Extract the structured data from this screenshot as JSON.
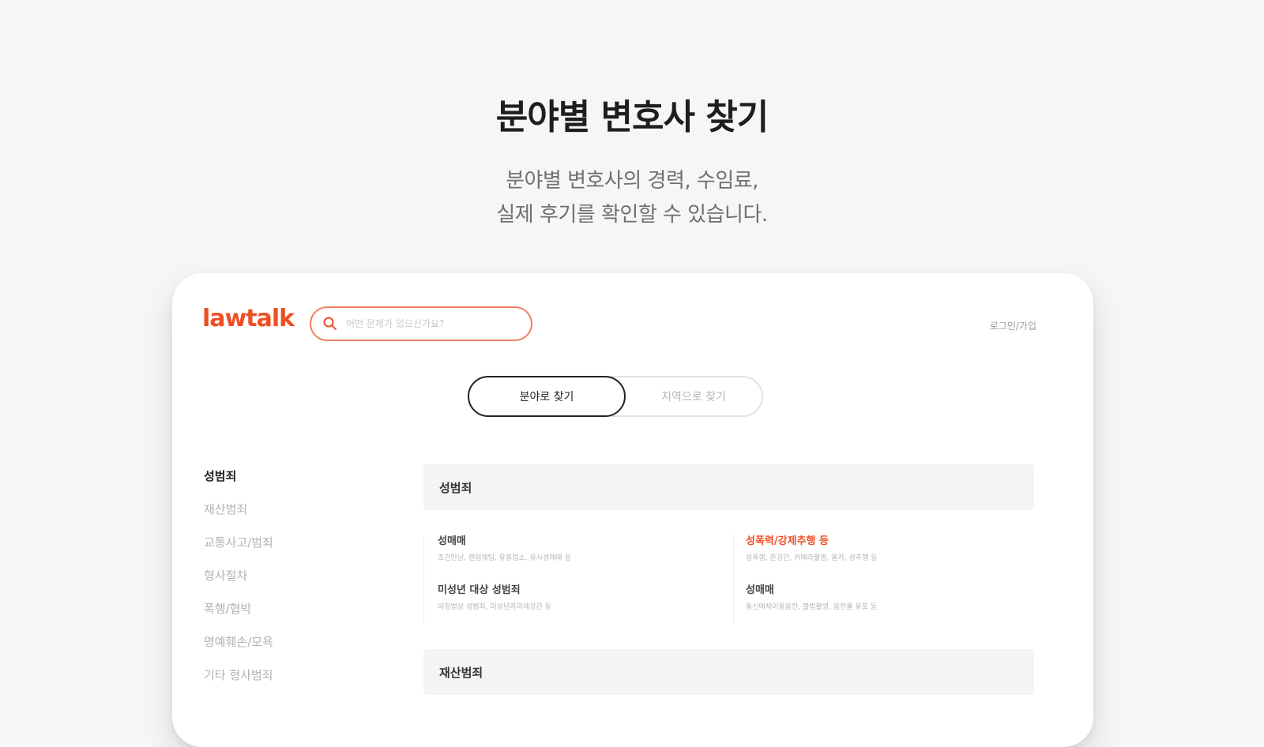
{
  "hero": {
    "title": "분야별 변호사 찾기",
    "subtitle_line1": "분야별 변호사의 경력, 수임료,",
    "subtitle_line2": "실제 후기를 확인할 수 있습니다."
  },
  "header": {
    "logo": "lawtalk",
    "search_placeholder": "어떤 문제가 있으신가요?",
    "login_label": "로그인/가입"
  },
  "toggle": {
    "by_field": "분야로 찾기",
    "by_region": "지역으로 찾기"
  },
  "sidebar": {
    "items": [
      {
        "label": "성범죄"
      },
      {
        "label": "재산범죄"
      },
      {
        "label": "교통사고/범죄"
      },
      {
        "label": "형사절차"
      },
      {
        "label": "폭행/협박"
      },
      {
        "label": "명예훼손/모욕"
      },
      {
        "label": "기타 형사범죄"
      }
    ]
  },
  "main": {
    "sections": [
      {
        "title": "성범죄",
        "categories": [
          {
            "title": "성매매",
            "desc": "조건만남, 랜덤채팅, 유흥업소, 유사성매매 등"
          },
          {
            "title": "성폭력/강제추행 등",
            "desc": "성폭행, 준강간, 카메라촬영, 몰카, 성추행 등"
          },
          {
            "title": "미성년 대상 성범죄",
            "desc": "아청법상 성범죄, 미성년자의제강간 등"
          },
          {
            "title": "성매매",
            "desc": "통신매체이용음란, 불법촬영, 음란물 유포 등"
          }
        ]
      },
      {
        "title": "재산범죄",
        "categories": []
      }
    ]
  },
  "colors": {
    "brand": "#ee4e24",
    "background": "#f5f6f8"
  }
}
